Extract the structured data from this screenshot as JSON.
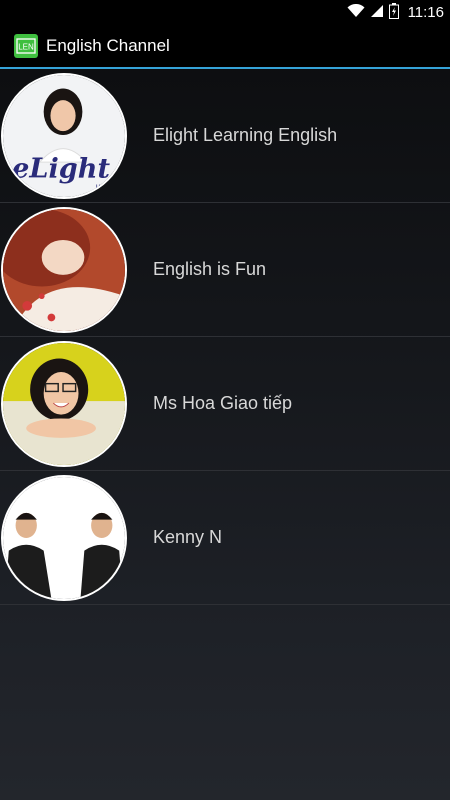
{
  "status_bar": {
    "time": "11:16",
    "icons": [
      "wifi-icon",
      "signal-icon",
      "battery-icon"
    ]
  },
  "action_bar": {
    "app_icon_text": "LEN",
    "title": "English Channel",
    "accent_color": "#35a3d8"
  },
  "channels": [
    {
      "name": "Elight Learning English",
      "avatar": "elight-avatar",
      "avatar_text": "eLight",
      "avatar_subtext": "up"
    },
    {
      "name": "English is Fun",
      "avatar": "english-is-fun-avatar"
    },
    {
      "name": "Ms Hoa Giao tiếp",
      "avatar": "ms-hoa-avatar"
    },
    {
      "name": "Kenny N",
      "avatar": "kenny-n-avatar"
    }
  ]
}
